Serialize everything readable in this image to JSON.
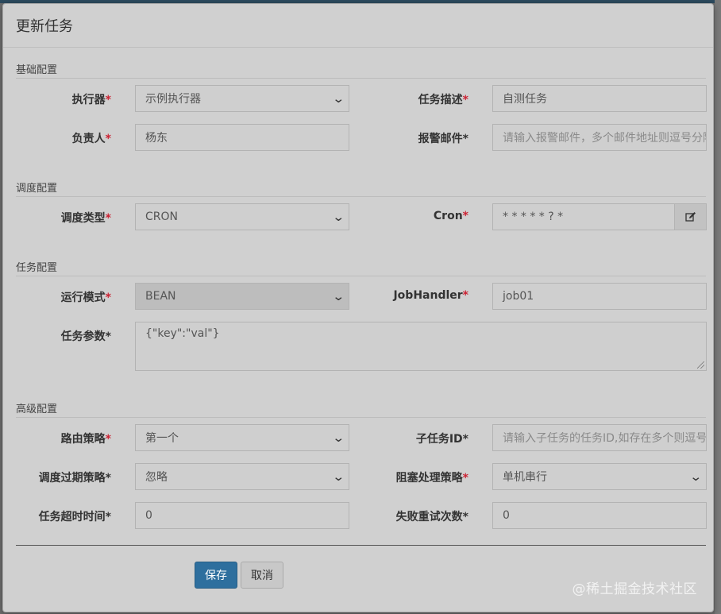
{
  "dialog": {
    "title": "更新任务"
  },
  "sections": {
    "basic": "基础配置",
    "schedule": "调度配置",
    "task": "任务配置",
    "advanced": "高级配置"
  },
  "fields": {
    "executor": {
      "label": "执行器",
      "value": "示例执行器"
    },
    "job_desc": {
      "label": "任务描述",
      "value": "自测任务"
    },
    "author": {
      "label": "负责人",
      "value": "杨东"
    },
    "alarm_email": {
      "label": "报警邮件",
      "placeholder": "请输入报警邮件，多个邮件地址则逗号分隔"
    },
    "schedule_type": {
      "label": "调度类型",
      "value": "CRON"
    },
    "cron": {
      "label": "Cron",
      "value": "* * * * * ? *"
    },
    "run_mode": {
      "label": "运行模式",
      "value": "BEAN"
    },
    "job_handler": {
      "label": "JobHandler",
      "value": "job01"
    },
    "job_param": {
      "label": "任务参数",
      "value": "{\"key\":\"val\"}"
    },
    "route_strategy": {
      "label": "路由策略",
      "value": "第一个"
    },
    "child_job_id": {
      "label": "子任务ID",
      "placeholder": "请输入子任务的任务ID,如存在多个则逗号分隔"
    },
    "misfire_strategy": {
      "label": "调度过期策略",
      "value": "忽略"
    },
    "block_strategy": {
      "label": "阻塞处理策略",
      "value": "单机串行"
    },
    "timeout": {
      "label": "任务超时时间",
      "value": "0"
    },
    "fail_retry": {
      "label": "失败重试次数",
      "value": "0"
    }
  },
  "buttons": {
    "save": "保存",
    "cancel": "取消"
  },
  "watermark": "@稀土掘金技术社区",
  "colors": {
    "required": "#cc2233",
    "primary": "#2e6f9e"
  }
}
